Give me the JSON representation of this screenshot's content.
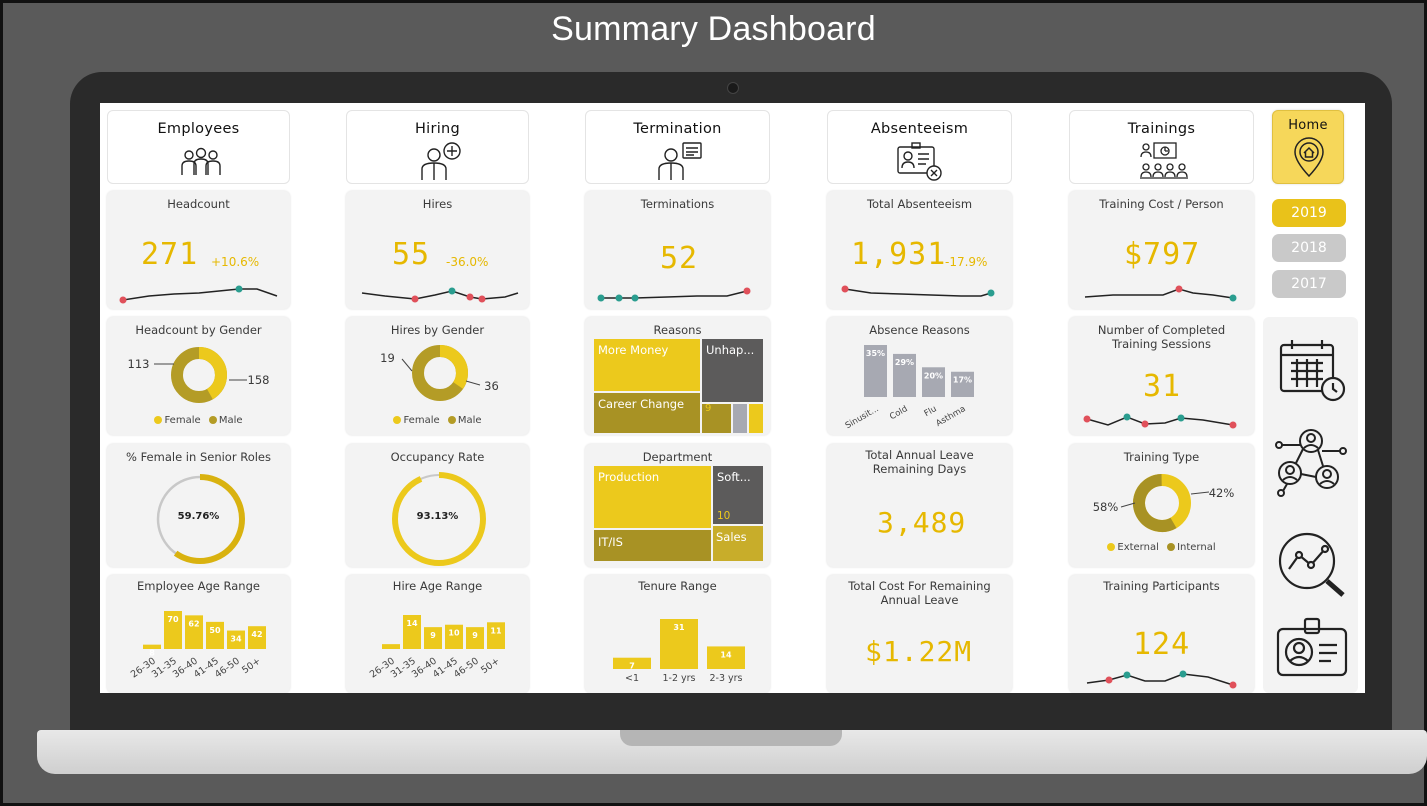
{
  "page_title": "Summary Dashboard",
  "colors": {
    "yellow": "#e9c21a",
    "olive": "#a89224",
    "dark": "#5a5a5a",
    "gray": "#a7a9b2",
    "accent_red": "#e0505a",
    "accent_teal": "#2a9d8f"
  },
  "nav": {
    "employees": "Employees",
    "hiring": "Hiring",
    "termination": "Termination",
    "absenteeism": "Absenteeism",
    "trainings": "Trainings",
    "home": "Home"
  },
  "years": [
    "2019",
    "2018",
    "2017"
  ],
  "kpis": {
    "headcount": {
      "title": "Headcount",
      "value": "271",
      "delta": "+10.6%"
    },
    "hires": {
      "title": "Hires",
      "value": "55",
      "delta": "-36.0%"
    },
    "terminations": {
      "title": "Terminations",
      "value": "52"
    },
    "absenteeism": {
      "title": "Total Absenteeism",
      "value": "1,931",
      "delta": "-17.9%"
    },
    "training_cost": {
      "title": "Training Cost / Person",
      "value": "$797"
    },
    "completed_sessions": {
      "title_1": "Number of Completed",
      "title_2": "Training Sessions",
      "value": "31"
    },
    "leave_days": {
      "title_1": "Total Annual Leave",
      "title_2": "Remaining Days",
      "value": "3,489"
    },
    "leave_cost": {
      "title_1": "Total Cost For Remaining",
      "title_2": "Annual Leave",
      "value": "$1.22M"
    },
    "participants": {
      "title": "Training Participants",
      "value": "124"
    }
  },
  "headcount_gender": {
    "title": "Headcount by Gender",
    "female": "113",
    "male": "158",
    "legend_female": "Female",
    "legend_male": "Male"
  },
  "hires_gender": {
    "title": "Hires by Gender",
    "female": "19",
    "male": "36",
    "legend_female": "Female",
    "legend_male": "Male"
  },
  "reasons": {
    "title": "Reasons",
    "more_money": "More Money",
    "unhappy": "Unhap...",
    "career_change": "Career Change",
    "small_value": "9"
  },
  "absence": {
    "title": "Absence Reasons",
    "labels": [
      "Sinusit...",
      "Cold",
      "Flu",
      "Asthma"
    ],
    "values": [
      "35%",
      "29%",
      "20%",
      "17%"
    ],
    "numbers": [
      35,
      29,
      20,
      17
    ]
  },
  "female_senior": {
    "title": "% Female in Senior Roles",
    "value": "59.76%",
    "fraction": 0.5976
  },
  "occupancy": {
    "title": "Occupancy Rate",
    "value": "93.13%",
    "fraction": 0.9313
  },
  "department": {
    "title": "Department",
    "production": "Production",
    "software": "Soft...",
    "it": "IT/IS",
    "sales": "Sales",
    "small_value": "10"
  },
  "training_type": {
    "title": "Training Type",
    "external_pct": "58%",
    "internal_pct": "42%",
    "legend_external": "External",
    "legend_internal": "Internal"
  },
  "age_range": {
    "title": "Employee Age Range",
    "labels": [
      "26-30",
      "31-35",
      "36-40",
      "41-45",
      "46-50",
      "50+"
    ],
    "values": [
      "8",
      "70",
      "62",
      "50",
      "34",
      "42"
    ],
    "numbers": [
      8,
      70,
      62,
      50,
      34,
      42
    ]
  },
  "hire_age_range": {
    "title": "Hire Age Range",
    "labels": [
      "26-30",
      "31-35",
      "36-40",
      "41-45",
      "46-50",
      "50+"
    ],
    "values": [
      "",
      "14",
      "9",
      "10",
      "9",
      "11"
    ],
    "numbers": [
      2,
      14,
      9,
      10,
      9,
      11
    ]
  },
  "tenure": {
    "title": "Tenure Range",
    "labels": [
      "<1",
      "1-2 yrs",
      "2-3 yrs"
    ],
    "values": [
      "7",
      "31",
      "14"
    ],
    "numbers": [
      7,
      31,
      14
    ]
  },
  "side_icons": [
    "calendar-clock-icon",
    "network-people-icon",
    "analytics-search-icon",
    "id-badge-icon"
  ]
}
